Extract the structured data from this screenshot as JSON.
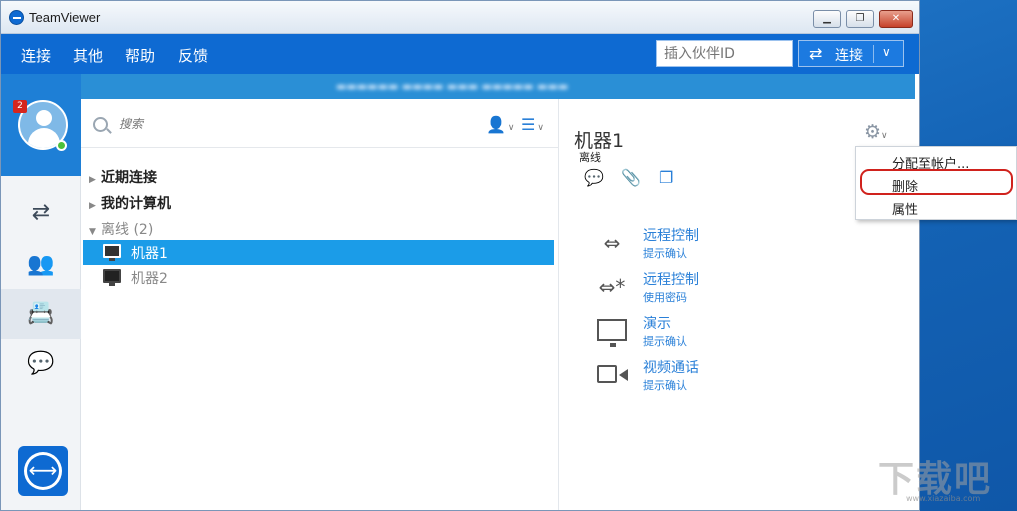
{
  "window": {
    "title": "TeamViewer"
  },
  "menu": {
    "items": [
      "连接",
      "其他",
      "帮助",
      "反馈"
    ],
    "partner_placeholder": "插入伙伴ID",
    "connect_label": "连接"
  },
  "profile": {
    "notification_count": "2"
  },
  "search": {
    "placeholder": "搜索"
  },
  "groups": {
    "recent": "近期连接",
    "my_computers": "我的计算机",
    "offline": "离线 (2)"
  },
  "computers": [
    {
      "name": "机器1",
      "selected": true
    },
    {
      "name": "机器2",
      "selected": false
    }
  ],
  "detail": {
    "title": "机器1",
    "status": "离线",
    "actions": [
      {
        "icon": "remote-control-icon",
        "main": "远程控制",
        "sub": "提示确认"
      },
      {
        "icon": "remote-control-password-icon",
        "main": "远程控制",
        "sub": "使用密码"
      },
      {
        "icon": "presentation-icon",
        "main": "演示",
        "sub": "提示确认"
      },
      {
        "icon": "video-call-icon",
        "main": "视频通话",
        "sub": "提示确认"
      }
    ]
  },
  "context_menu": {
    "items": [
      "分配至帐户...",
      "删除",
      "属性"
    ],
    "highlighted": "删除"
  },
  "watermark": {
    "text": "下载吧",
    "sub": "www.xiazaiba.com"
  },
  "colors": {
    "brand_blue": "#0e6ad2",
    "selection": "#1b9ce8",
    "highlight_red": "#d0221d"
  }
}
